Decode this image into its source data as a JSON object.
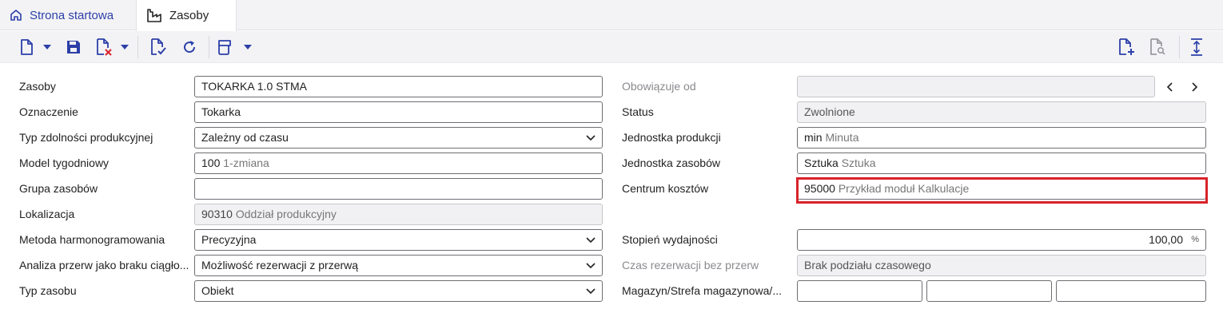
{
  "tabs": {
    "home_label": "Strona startowa",
    "active_label": "Zasoby"
  },
  "toolbar": {
    "icons": [
      "new-document-icon",
      "dropdown-caret-icon",
      "save-icon",
      "delete-document-icon",
      "dropdown-caret-icon",
      "validate-icon",
      "refresh-icon",
      "print-icon",
      "dropdown-caret-icon",
      "new-document-plus-icon",
      "document-search-icon",
      "expand-vertical-icon"
    ]
  },
  "left": {
    "zasoby": {
      "label": "Zasoby",
      "value": "TOKARKA 1.0 STMA"
    },
    "oznaczenie": {
      "label": "Oznaczenie",
      "value": "Tokarka"
    },
    "typ_zdolnosci": {
      "label": "Typ zdolności produkcyjnej",
      "value": "Zależny od czasu"
    },
    "model_tygodniowy": {
      "label": "Model tygodniowy",
      "code": "100",
      "desc": "1-zmiana"
    },
    "grupa_zasobow": {
      "label": "Grupa zasobów",
      "value": ""
    },
    "lokalizacja": {
      "label": "Lokalizacja",
      "code": "90310",
      "desc": "Oddział produkcyjny"
    },
    "metoda": {
      "label": "Metoda harmonogramowania",
      "value": "Precyzyjna"
    },
    "analiza": {
      "label": "Analiza przerw jako braku ciągło...",
      "value": "Możliwość rezerwacji z przerwą"
    },
    "typ_zasobu": {
      "label": "Typ zasobu",
      "value": "Obiekt"
    }
  },
  "right": {
    "obowiazuje_od": {
      "label": "Obowiązuje od",
      "value": ""
    },
    "status": {
      "label": "Status",
      "value": "Zwolnione"
    },
    "jednostka_produkcji": {
      "label": "Jednostka produkcji",
      "code": "min",
      "desc": "Minuta"
    },
    "jednostka_zasobow": {
      "label": "Jednostka zasobów",
      "code": "Sztuka",
      "desc": "Sztuka"
    },
    "centrum_kosztow": {
      "label": "Centrum kosztów",
      "code": "95000",
      "desc": "Przykład moduł Kalkulacje"
    },
    "stopien": {
      "label": "Stopień wydajności",
      "value": "100,00",
      "unit": "%"
    },
    "czas_rezerwacji": {
      "label": "Czas rezerwacji bez przerw",
      "value": "Brak podziału czasowego"
    },
    "magazyn": {
      "label": "Magazyn/Strefa magazynowa/...",
      "values": [
        "",
        "",
        ""
      ]
    }
  },
  "colors": {
    "accent": "#2c3fa8",
    "highlight": "#d8232a"
  }
}
